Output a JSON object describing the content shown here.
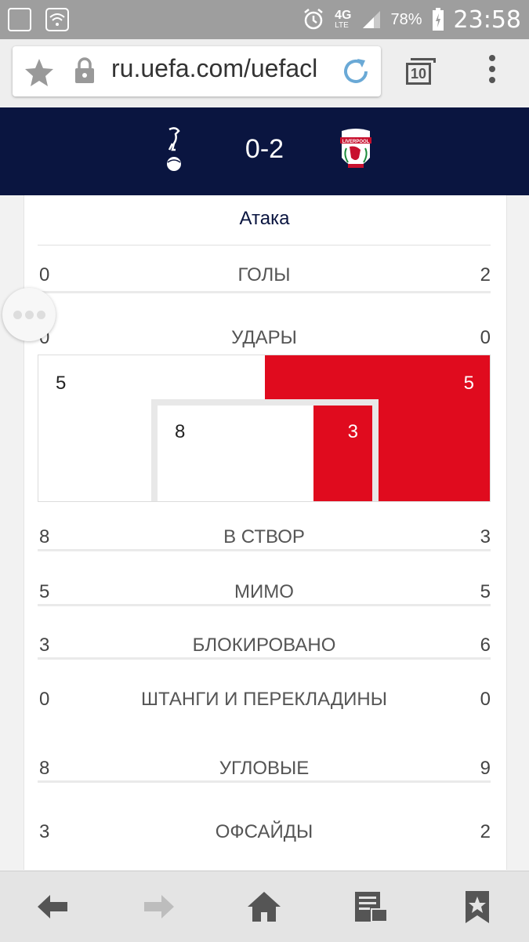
{
  "status_bar": {
    "network": "4G",
    "network_sub": "LTE",
    "battery": "78%",
    "time": "23:58",
    "icons": [
      "notification-icon",
      "wifi-icon",
      "alarm-icon",
      "signal-icon",
      "battery-icon"
    ]
  },
  "browser": {
    "url": "ru.uefa.com/uefacl",
    "tab_count": "10"
  },
  "match": {
    "score": "0-2",
    "home_crest": "tottenham-crest-icon",
    "away_crest": "liverpool-crest-icon",
    "away_crest_text": "LIVERPOOL"
  },
  "attack": {
    "title": "Атака",
    "goals": {
      "label": "ГОЛЫ",
      "home": "0",
      "away": "2"
    },
    "shots": {
      "label": "УДАРЫ",
      "home": "0",
      "away": "0"
    },
    "shots_graphic": {
      "outer_home": "5",
      "outer_away": "5",
      "inner_home": "8",
      "inner_away": "3",
      "colors": {
        "away": "#e00b1e",
        "home": "#ffffff",
        "goal_frame": "#e8e8e8"
      }
    },
    "stats": [
      {
        "label": "В СТВОР",
        "home": "8",
        "away": "3"
      },
      {
        "label": "МИМО",
        "home": "5",
        "away": "5"
      },
      {
        "label": "БЛОКИРОВАНО",
        "home": "3",
        "away": "6"
      },
      {
        "label": "ШТАНГИ И ПЕРЕКЛАДИНЫ",
        "home": "0",
        "away": "0"
      },
      {
        "label": "УГЛОВЫЕ",
        "home": "8",
        "away": "9"
      },
      {
        "label": "ОФСАЙДЫ",
        "home": "3",
        "away": "2"
      }
    ]
  },
  "bottom_nav": [
    "back-icon",
    "forward-icon",
    "home-icon",
    "reading-list-icon",
    "bookmark-icon"
  ],
  "colors": {
    "navy": "#0a1540",
    "red": "#e00b1e"
  }
}
